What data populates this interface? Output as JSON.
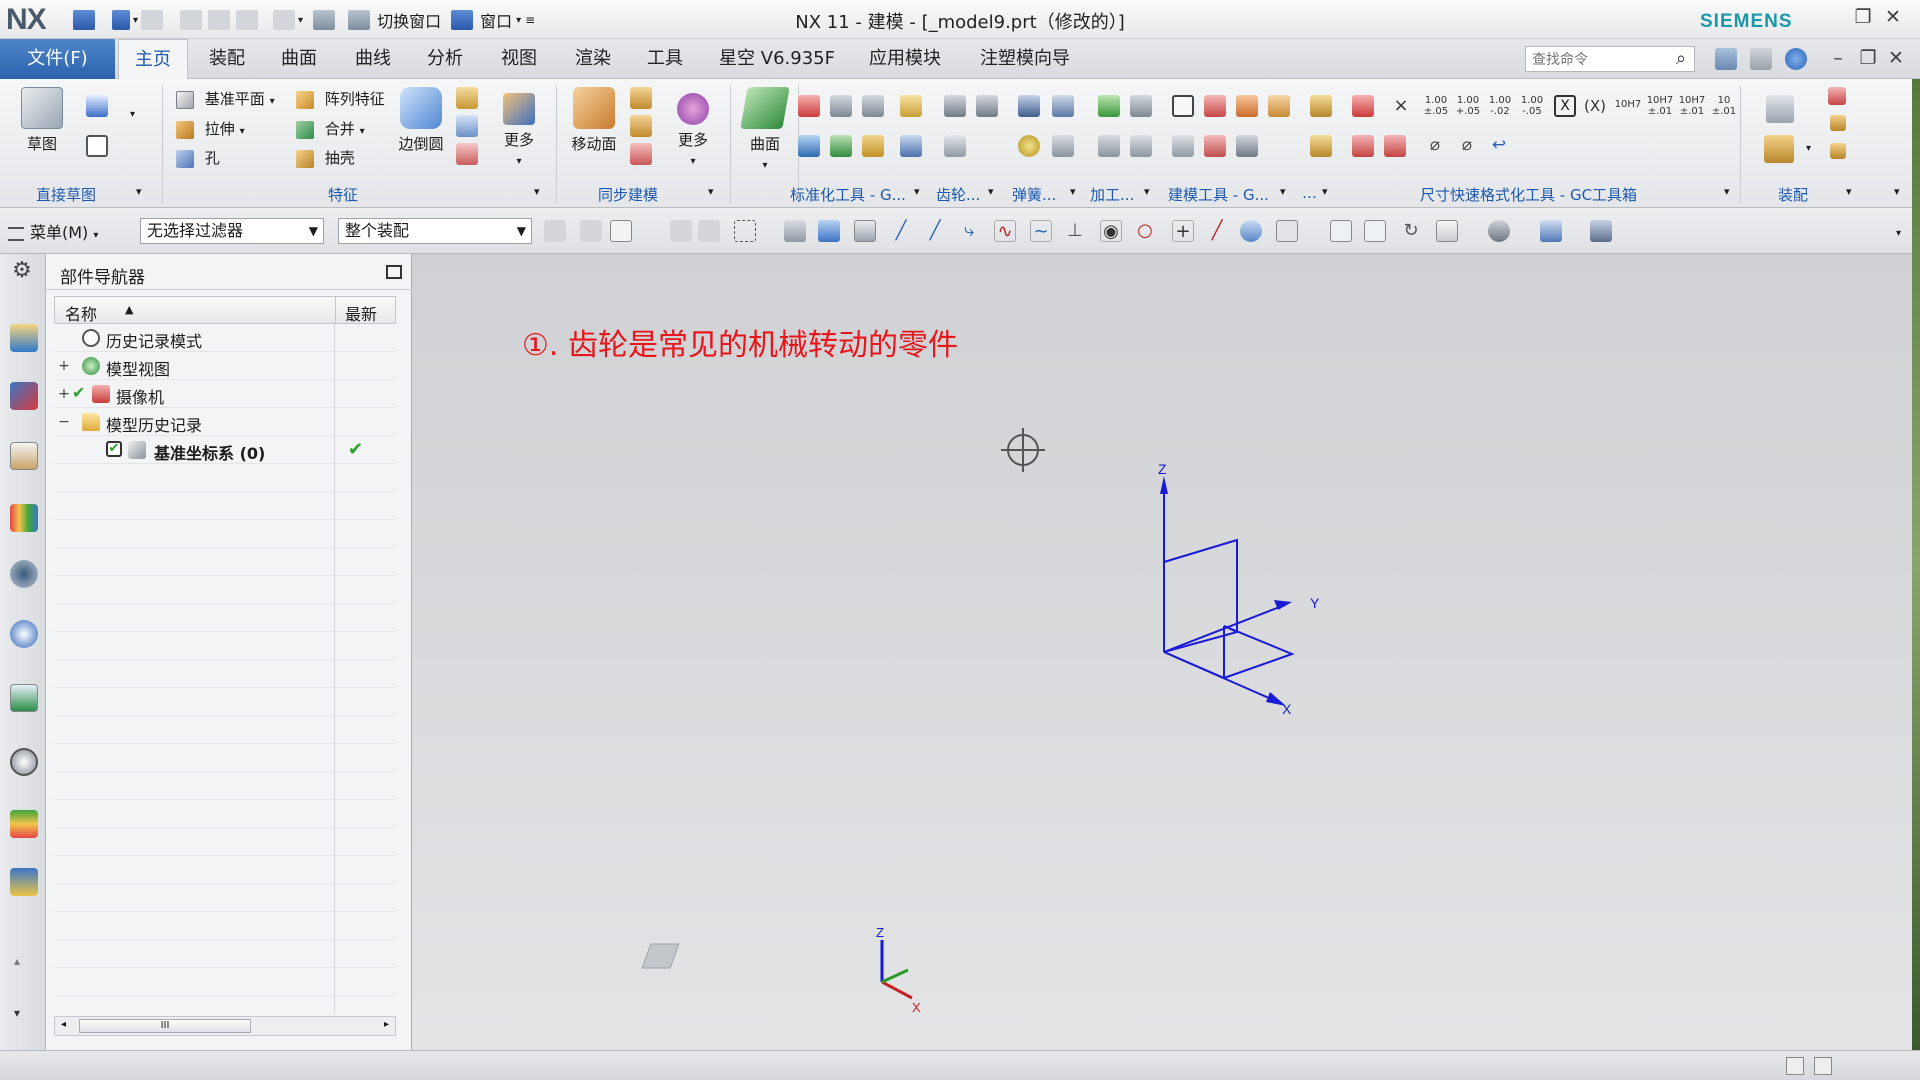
{
  "app": {
    "logo": "NX",
    "title": "NX 11 - 建模 - [_model9.prt（修改的）]",
    "brand": "SIEMENS",
    "brand_color": "#1b97a8"
  },
  "quick_access": {
    "switch_window": "切换窗口",
    "window": "窗口"
  },
  "menubar": {
    "file": "文件(F)",
    "tabs": [
      "主页",
      "装配",
      "曲面",
      "曲线",
      "分析",
      "视图",
      "渲染",
      "工具",
      "星空 V6.935F",
      "应用模块",
      "注塑模向导"
    ],
    "active_tab": "主页",
    "search_placeholder": "查找命令"
  },
  "ribbon": {
    "sketch": {
      "label": "草图",
      "group": "直接草图"
    },
    "feature": {
      "datum_plane": "基准平面",
      "pattern_feature": "阵列特征",
      "extrude": "拉伸",
      "unite": "合并",
      "hole": "孔",
      "shell": "抽壳",
      "edge_blend": "边倒圆",
      "more": "更多",
      "group": "特征"
    },
    "sync": {
      "move_face": "移动面",
      "more": "更多",
      "group": "同步建模"
    },
    "surface": {
      "label": "曲面"
    },
    "groups": {
      "std_tools": "标准化工具 - G...",
      "gear": "齿轮...",
      "spring": "弹簧...",
      "machining": "加工...",
      "model_tools": "建模工具 - G...",
      "misc": "…",
      "dim_tools": "尺寸快速格式化工具 - GC工具箱",
      "assembly": "装配"
    },
    "dim_values": [
      "1.00",
      "1.00",
      "1.00",
      "1.00",
      "10H7",
      "10H7",
      "10H7",
      "10"
    ],
    "dim_subvalues": [
      "±.05",
      "+.05",
      "-.02",
      "-.05",
      "",
      "±.01",
      "±.01",
      "±.01"
    ]
  },
  "toolbar2": {
    "menu": "菜单(M)",
    "filter": "无选择过滤器",
    "scope": "整个装配"
  },
  "navigator": {
    "title": "部件导航器",
    "col_name": "名称",
    "col_latest": "最新",
    "rows": [
      {
        "label": "历史记录模式"
      },
      {
        "label": "模型视图"
      },
      {
        "label": "摄像机"
      },
      {
        "label": "模型历史记录"
      },
      {
        "label": "基准坐标系 (0)"
      }
    ],
    "scroll_grip": "III"
  },
  "viewport": {
    "annotation": "①. 齿轮是常见的机械转动的零件",
    "annotation_color": "#e8161a",
    "axis_x": "X",
    "axis_y": "Y",
    "axis_z": "Z",
    "axis_color": "#1a1ad6"
  },
  "colors": {
    "accent": "#1d59ae",
    "check": "#2aa12a"
  }
}
